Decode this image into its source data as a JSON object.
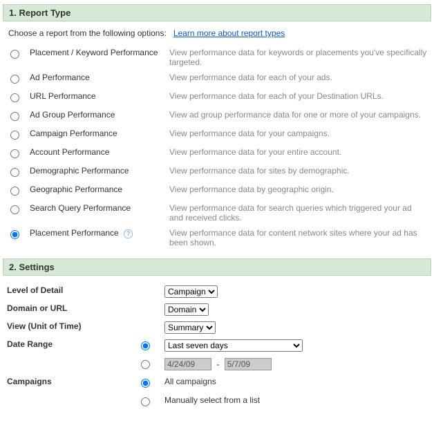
{
  "section1": {
    "title": "1. Report Type"
  },
  "intro": {
    "text": "Choose a report from the following options:",
    "link": "Learn more about report types"
  },
  "report_types": [
    {
      "label": "Placement / Keyword Performance",
      "desc": "View performance data for keywords or placements you've specifically targeted.",
      "selected": false
    },
    {
      "label": "Ad Performance",
      "desc": "View performance data for each of your ads.",
      "selected": false
    },
    {
      "label": "URL Performance",
      "desc": "View performance data for each of your Destination URLs.",
      "selected": false
    },
    {
      "label": "Ad Group Performance",
      "desc": "View ad group performance data for one or more of your campaigns.",
      "selected": false
    },
    {
      "label": "Campaign Performance",
      "desc": "View performance data for your campaigns.",
      "selected": false
    },
    {
      "label": "Account Performance",
      "desc": "View performance data for your entire account.",
      "selected": false
    },
    {
      "label": "Demographic Performance",
      "desc": "View performance data for sites by demographic.",
      "selected": false
    },
    {
      "label": "Geographic Performance",
      "desc": "View performance data by geographic origin.",
      "selected": false
    },
    {
      "label": "Search Query Performance",
      "desc": "View performance data for search queries which triggered your ad and received clicks.",
      "selected": false
    },
    {
      "label": "Placement Performance",
      "desc": "View performance data for content network sites where your ad has been shown.",
      "selected": true,
      "help": true
    }
  ],
  "section2": {
    "title": "2. Settings"
  },
  "settings": {
    "level_of_detail": {
      "label": "Level of Detail",
      "value": "Campaign"
    },
    "domain_or_url": {
      "label": "Domain or URL",
      "value": "Domain"
    },
    "view": {
      "label": "View (Unit of Time)",
      "value": "Summary"
    },
    "date_range": {
      "label": "Date Range",
      "preset": "Last seven days",
      "preset_selected": true,
      "start": "4/24/09",
      "end": "5/7/09"
    },
    "campaigns": {
      "label": "Campaigns",
      "all_label": "All campaigns",
      "manual_label": "Manually select from a list",
      "all_selected": true
    }
  },
  "help_icon_glyph": "?"
}
